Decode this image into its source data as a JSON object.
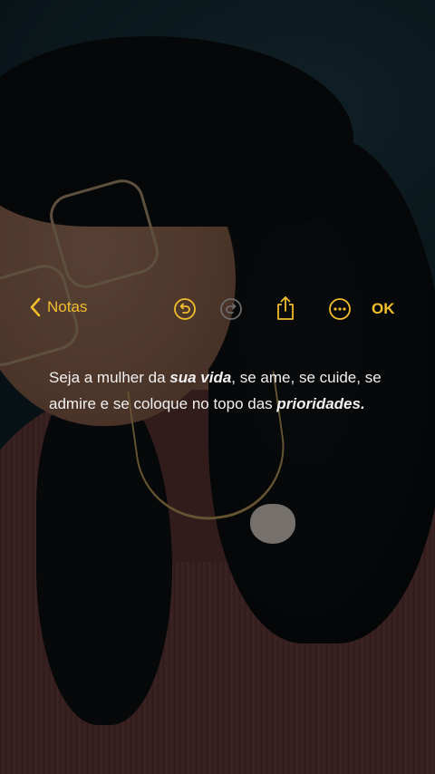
{
  "toolbar": {
    "back_label": "Notas",
    "ok_label": "OK",
    "accent_color": "#f2be2c",
    "icons": [
      "chevron-left-icon",
      "undo-icon",
      "redo-icon",
      "share-icon",
      "more-icon"
    ]
  },
  "note": {
    "text_1": "Seja a mulher da ",
    "emphasis_1": "sua vida",
    "text_2": ", se ame, se cuide, se admire e se coloque no topo das ",
    "emphasis_2": "prioridades."
  }
}
